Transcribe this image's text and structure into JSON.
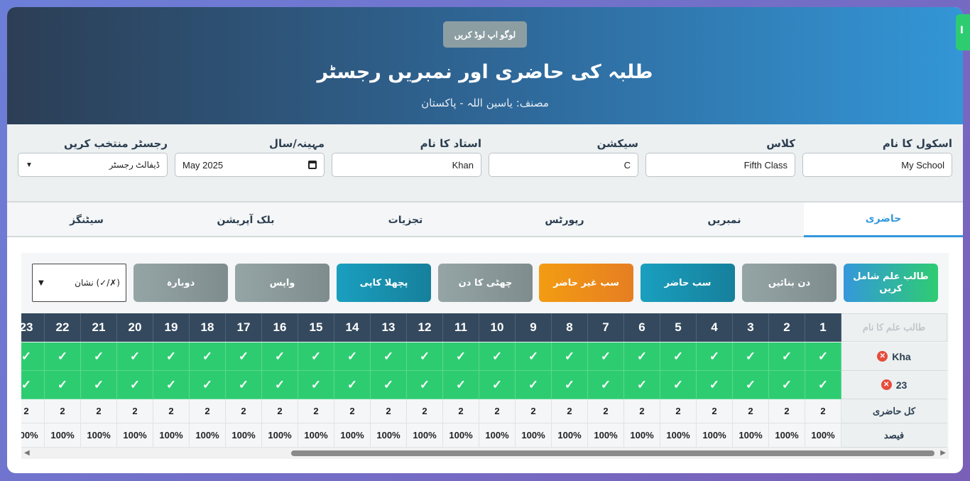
{
  "header": {
    "logo_button": "لوگو اپ لوڈ کریں",
    "title": "طلبہ کی حاضری اور نمبریں رجسٹر",
    "author": "مصنف: یاسین اللہ - پاکستان",
    "side_tab": "ا"
  },
  "fields": {
    "school_label": "اسکول کا نام",
    "school_value": "My School",
    "class_label": "کلاس",
    "class_value": "Fifth Class",
    "section_label": "سیکشن",
    "section_value": "C",
    "teacher_label": "استاد کا نام",
    "teacher_value": "Khan",
    "month_label": "مہینہ/سال",
    "month_value": "May 2025",
    "register_label": "رجسٹر منتخب کریں",
    "register_value": "ڈیفالٹ رجسٹر"
  },
  "tabs": [
    "حاضری",
    "نمبریں",
    "رپورٹس",
    "تجزیات",
    "بلک آپریشن",
    "سیٹنگز"
  ],
  "actions": {
    "add_student": "طالب علم شامل کریں",
    "set_days": "دن بنائیں",
    "all_present": "سب حاضر",
    "all_absent": "سب غیر حاضر",
    "holiday": "چھٹی کا دن",
    "prev_copy": "پچھلا کاپی",
    "undo": "واپس",
    "redo": "دوبارہ",
    "mark_select": "نشان (✓/✗)"
  },
  "table": {
    "name_header": "طالب علم کا نام",
    "days": [
      "1",
      "2",
      "3",
      "4",
      "5",
      "6",
      "7",
      "8",
      "9",
      "10",
      "11",
      "12",
      "13",
      "14",
      "15",
      "16",
      "17",
      "18",
      "19",
      "20",
      "21",
      "22",
      "23"
    ],
    "students": [
      {
        "name": "Kha",
        "mark": "✓"
      },
      {
        "name": "23",
        "mark": "✓"
      }
    ],
    "delete_icon": "✕",
    "total_label": "کل حاضری",
    "total_value": "2",
    "percent_label": "فیصد",
    "percent_value": "100%"
  },
  "colors": {
    "present": "#2ecc71",
    "header": "#34495e",
    "accent": "#3498db"
  }
}
